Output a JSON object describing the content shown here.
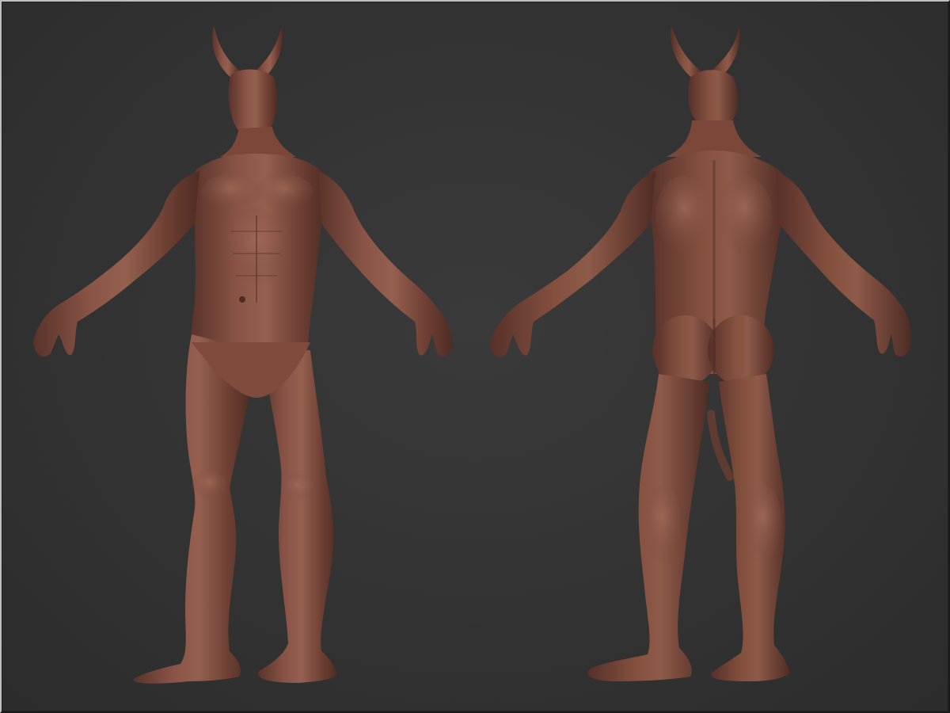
{
  "scene": {
    "background_color": "#333333",
    "frame_color": "#bfbfbf",
    "skin_color": "#7a4a3e",
    "skin_highlight": "#9a6455",
    "skin_shadow": "#4e2c24",
    "views": [
      {
        "name": "front-view",
        "kind": "front"
      },
      {
        "name": "back-view",
        "kind": "back"
      }
    ]
  }
}
